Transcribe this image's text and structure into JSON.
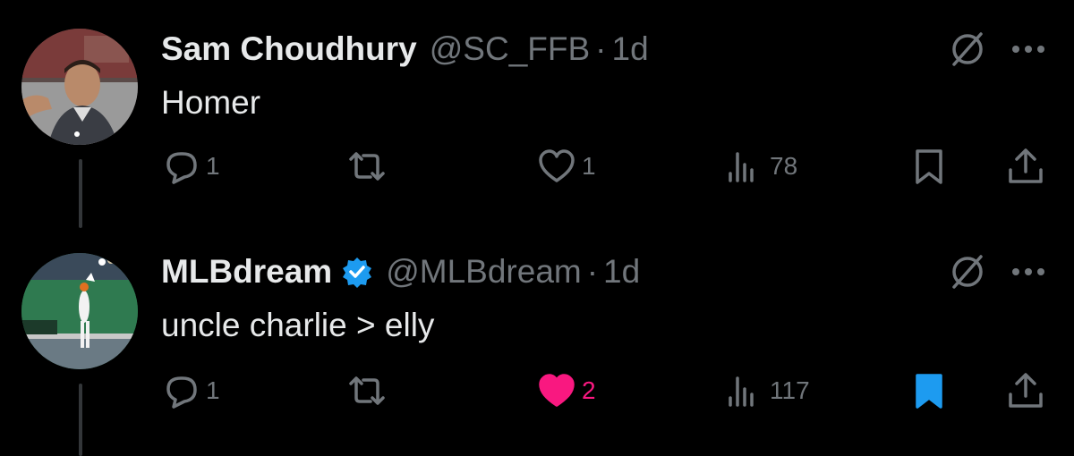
{
  "tweets": [
    {
      "name": "Sam Choudhury",
      "handle": "@SC_FFB",
      "dot": "·",
      "time": "1d",
      "verified": false,
      "text": "Homer",
      "replies": "1",
      "retweets": "",
      "likes": "1",
      "liked": false,
      "views": "78",
      "bookmarked": false
    },
    {
      "name": "MLBdream",
      "handle": "@MLBdream",
      "dot": "·",
      "time": "1d",
      "verified": true,
      "text": "uncle charlie > elly",
      "replies": "1",
      "retweets": "",
      "likes": "2",
      "liked": true,
      "views": "117",
      "bookmarked": true
    }
  ],
  "colors": {
    "background": "#000000",
    "primary_text": "#e7e9ea",
    "secondary_text": "#71767b",
    "like_active": "#f91880",
    "bookmark_active": "#1d9bf0",
    "verified_badge": "#1d9bf0"
  },
  "icons": [
    "reply-icon",
    "retweet-icon",
    "like-icon",
    "views-icon",
    "bookmark-icon",
    "share-icon",
    "grok-icon",
    "more-icon",
    "verified-badge-icon"
  ]
}
